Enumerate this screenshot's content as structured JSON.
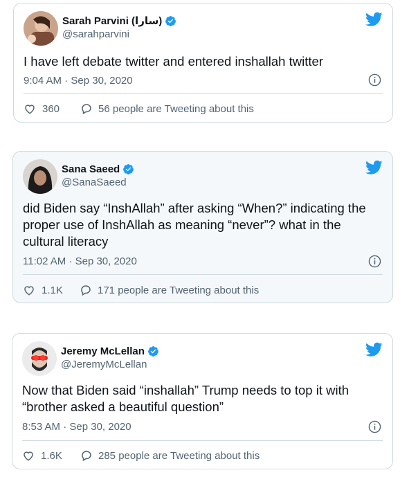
{
  "colors": {
    "twitter_blue": "#1d9bf0",
    "text": "#0f1419",
    "muted": "#536471",
    "border": "#cfd9de"
  },
  "icons": {
    "brand": "twitter-bird-icon",
    "verified": "verified-badge-icon",
    "info": "info-icon",
    "like": "heart-icon",
    "conversation": "speech-bubble-icon"
  },
  "tweets": [
    {
      "name": "Sarah Parvini (سارا)",
      "handle": "@sarahparvini",
      "text": "I have left debate twitter and entered inshallah twitter",
      "timestamp": "9:04 AM · Sep 30, 2020",
      "likes": "360",
      "conversation": "56 people are Tweeting about this"
    },
    {
      "name": "Sana Saeed",
      "handle": "@SanaSaeed",
      "text": "did Biden say “InshAllah” after asking “When?” indicating the proper use of InshAllah as meaning “never”? what in the cultural literacy",
      "timestamp": "11:02 AM · Sep 30, 2020",
      "likes": "1.1K",
      "conversation": "171 people are Tweeting about this"
    },
    {
      "name": "Jeremy McLellan",
      "handle": "@JeremyMcLellan",
      "text": "Now that Biden said “inshallah” Trump needs to top it with “brother asked a beautiful question”",
      "timestamp": "8:53 AM · Sep 30, 2020",
      "likes": "1.6K",
      "conversation": "285 people are Tweeting about this"
    }
  ]
}
